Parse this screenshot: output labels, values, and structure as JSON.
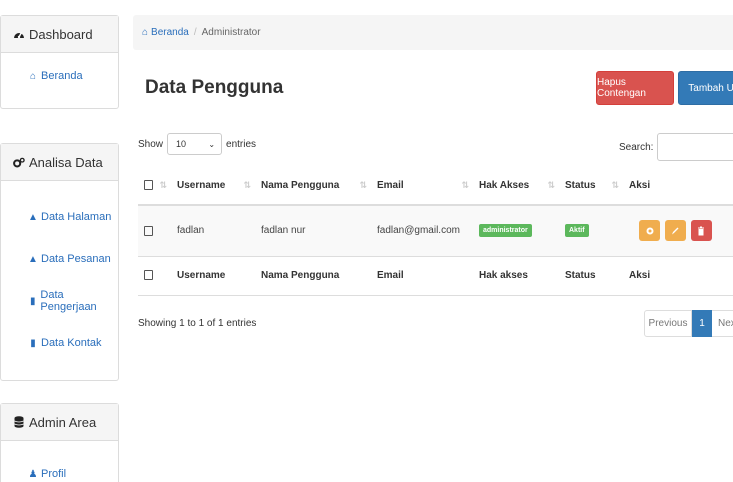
{
  "sidebar": {
    "dashboard": {
      "title": "Dashboard",
      "icon": "tachometer-icon",
      "items": [
        {
          "label": "Beranda",
          "icon": "home-icon"
        }
      ]
    },
    "analisa": {
      "title": "Analisa Data",
      "icon": "cogs-icon",
      "items": [
        {
          "label": "Data Halaman",
          "icon": "bank-icon"
        },
        {
          "label": "Data Pesanan",
          "icon": "bank-icon"
        },
        {
          "label": "Data Pengerjaan",
          "icon": "book-icon"
        },
        {
          "label": "Data Kontak",
          "icon": "book-icon"
        }
      ]
    },
    "admin": {
      "title": "Admin Area",
      "icon": "database-icon",
      "items": [
        {
          "label": "Profil",
          "icon": "user-icon"
        }
      ]
    }
  },
  "breadcrumb": {
    "home": "Beranda",
    "current": "Administrator"
  },
  "page": {
    "title": "Data Pengguna",
    "btn_hapus": "Hapus Contengan",
    "btn_tambah": "Tambah User"
  },
  "table_controls": {
    "show": "Show",
    "length": "10",
    "entries": "entries",
    "search": "Search:"
  },
  "table": {
    "headers": [
      "Username",
      "Nama Pengguna",
      "Email",
      "Hak Akses",
      "Status",
      "Aksi"
    ],
    "footers": [
      "Username",
      "Nama Pengguna",
      "Email",
      "Hak akses",
      "Status",
      "Aksi"
    ],
    "rows": [
      {
        "username": "fadlan",
        "nama": "fadlan nur",
        "email": "fadlan@gmail.com",
        "hak_akses": "administrator",
        "status": "Aktif"
      }
    ]
  },
  "footer": {
    "showing": "Showing 1 to 1 of 1 entries",
    "previous": "Previous",
    "page": "1",
    "next": "Next"
  },
  "colors": {
    "link": "#2a6ebb",
    "danger": "#d9534f",
    "primary": "#337ab7",
    "warning": "#f0ad4e",
    "success": "#5cb85c"
  }
}
